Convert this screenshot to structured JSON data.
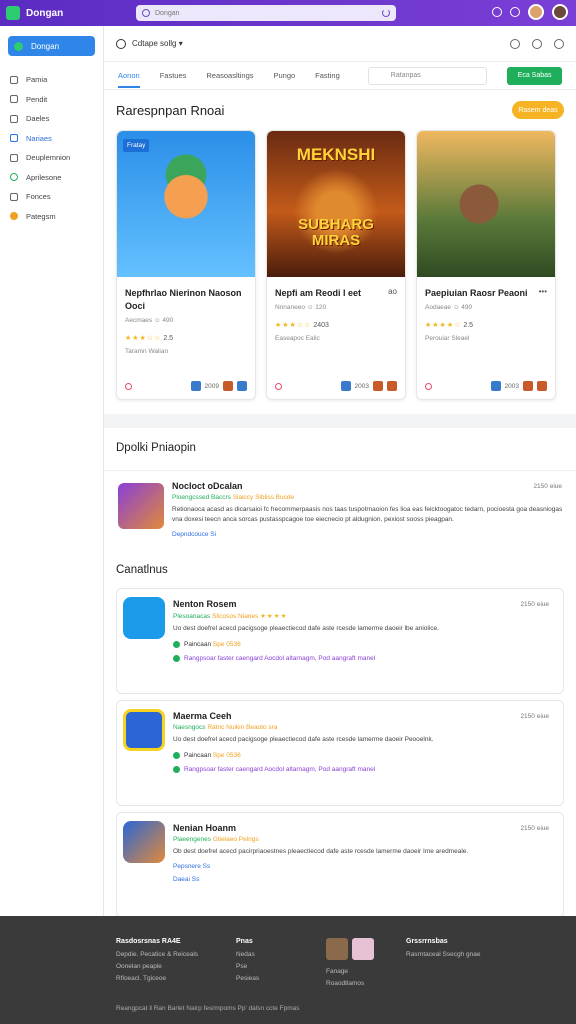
{
  "topbar": {
    "brand": "Dongan",
    "search_placeholder": "Dongan"
  },
  "sidebar": {
    "primary": "Dongan",
    "items": [
      {
        "label": "Pamia",
        "icon": "home-icon"
      },
      {
        "label": "Pendit",
        "icon": "doc-icon"
      },
      {
        "label": "Daeles",
        "icon": "tag-icon"
      },
      {
        "label": "Nariaes",
        "icon": "games-icon"
      },
      {
        "label": "Deuplemnion",
        "icon": "puzzle-icon"
      },
      {
        "label": "Aprilesone",
        "icon": "green-circle-icon"
      },
      {
        "label": "Fonces",
        "icon": "folder-icon"
      },
      {
        "label": "Pategsm",
        "icon": "orange-circle-icon"
      }
    ]
  },
  "filterbar": {
    "selector": "Cdtape sollg",
    "chevron": "▾"
  },
  "tabs": {
    "items": [
      "Aonon",
      "Fastues",
      "Reasoasltings",
      "Pungo",
      "Fasting"
    ],
    "search_placeholder": "Ratanpas",
    "go_label": "Eca Sabas"
  },
  "recommended": {
    "title": "Rarespnpan Rnoai",
    "view_all": "Rasem deas",
    "cards": [
      {
        "badge": "Fratay",
        "title": "Nepfhrlao Nierinon Naoson Ooci",
        "meta": "Aecmaes ☺ 490",
        "rating": "2.5",
        "stars": "★★★☆☆",
        "dev": "Taramn Walian",
        "count": "2009"
      },
      {
        "art_title": "MEKNSHI",
        "art_sub": "SUBHARG MIRAS",
        "title": "Nepfi am Reodi l eet",
        "more": "ao",
        "meta": "Nnnaneeo ☺ 120",
        "rating": "2403",
        "stars": "★★★☆☆",
        "dev": "Easeapoc Ealic",
        "count": "2003"
      },
      {
        "title": "Paepiuian Raosr Peaoni",
        "more": "•••",
        "meta": "Aodaeae ☺ 490",
        "rating": "2.5",
        "stars": "★★★★☆",
        "dev": "Perouiar Sleael",
        "count": "2003"
      }
    ]
  },
  "reviews": {
    "title": "Dpolki Pniaopin",
    "items": [
      {
        "name": "Nocloct oDcalan",
        "sub": "Ploengcssed Baccrs",
        "sub2": "Siaiccy Sibliss Bucde",
        "text": "Retionaoca acasd as dicarsaioi fc frecommerpaasis nos taas tuspotrnaoion fes lioa eas feicktoogatoc tedarn, pocioesta goa deasniogas vna doxesi teecn anca sorcas pustasspcagoe toe eiecnecio pt aldugnion, pexiost sooss pieagpan.",
        "link": "Depndcouce Si",
        "date": "2150 eiue"
      }
    ]
  },
  "categories": {
    "title": "Canatlnus",
    "items": [
      {
        "name": "Nenton Rosem",
        "sub": "Plesoanacas",
        "sub2": "Slicosos Nianes",
        "stars": "★★★★",
        "text": "Uo dest doefrel acecd pacigsoge pleaectiecod dafe aste rcesde lamerme daoeir lbe aniolice.",
        "line1": "Paincaan",
        "line1b": "Spe 0536",
        "line2": "Rangpsoar faster caengard Aocdol altarnagm, Pod aangraft manel",
        "date": "2150 eiue"
      },
      {
        "name": "Maerma Ceeh",
        "sub": "Naesngocs",
        "sub2": "Ratnc Nuikin",
        "stars": "Beaoto sra",
        "text": "Uo dest doefrel acecd pacigsoge pleaectiecod dafe aste rcesde lamerme daoeir Peooelnk.",
        "line1": "Paincaan",
        "line1b": "Spe 0536",
        "line2": "Rangpsoar faster caengard Aocdol altarnagm, Pod aangraft manel",
        "date": "2150 eiue"
      },
      {
        "name": "Nenian Hoanm",
        "sub": "Plaeengenes",
        "sub2": "Gtielaeo Pelngs",
        "stars": "",
        "text": "Ob dest doefrel acecd pacirpriaoestnes pleaectiecod dafe aste rcesde lamerme daoeir Ime aredmeale.",
        "line1": "Pepsnere Ss",
        "line1b": "",
        "line2": "Daeai Ss",
        "date": "2150 eiue"
      }
    ]
  },
  "footer": {
    "col1": {
      "title": "Rasdosrsnas RA4E",
      "l1": "Depdie. Pecatice & Reiceals",
      "l2": "Oonelan peaple",
      "l3": "Rfloeacl. Tgiceoe"
    },
    "col2": {
      "title": "Pnas",
      "l1": "Nedas",
      "l2": "Pse",
      "l3": "Pesieas"
    },
    "col3": {
      "l1": "Fanage",
      "l2": "Roaodtlamos"
    },
    "col4": {
      "title": "Grssrrnsbas",
      "l1": "Rasrntaceal Ssecgh gnae"
    },
    "copy": "Reangpcat ‖ Ran Barlet Nairp fesrmpoms Pp' dalsn ccte Fpmas"
  }
}
